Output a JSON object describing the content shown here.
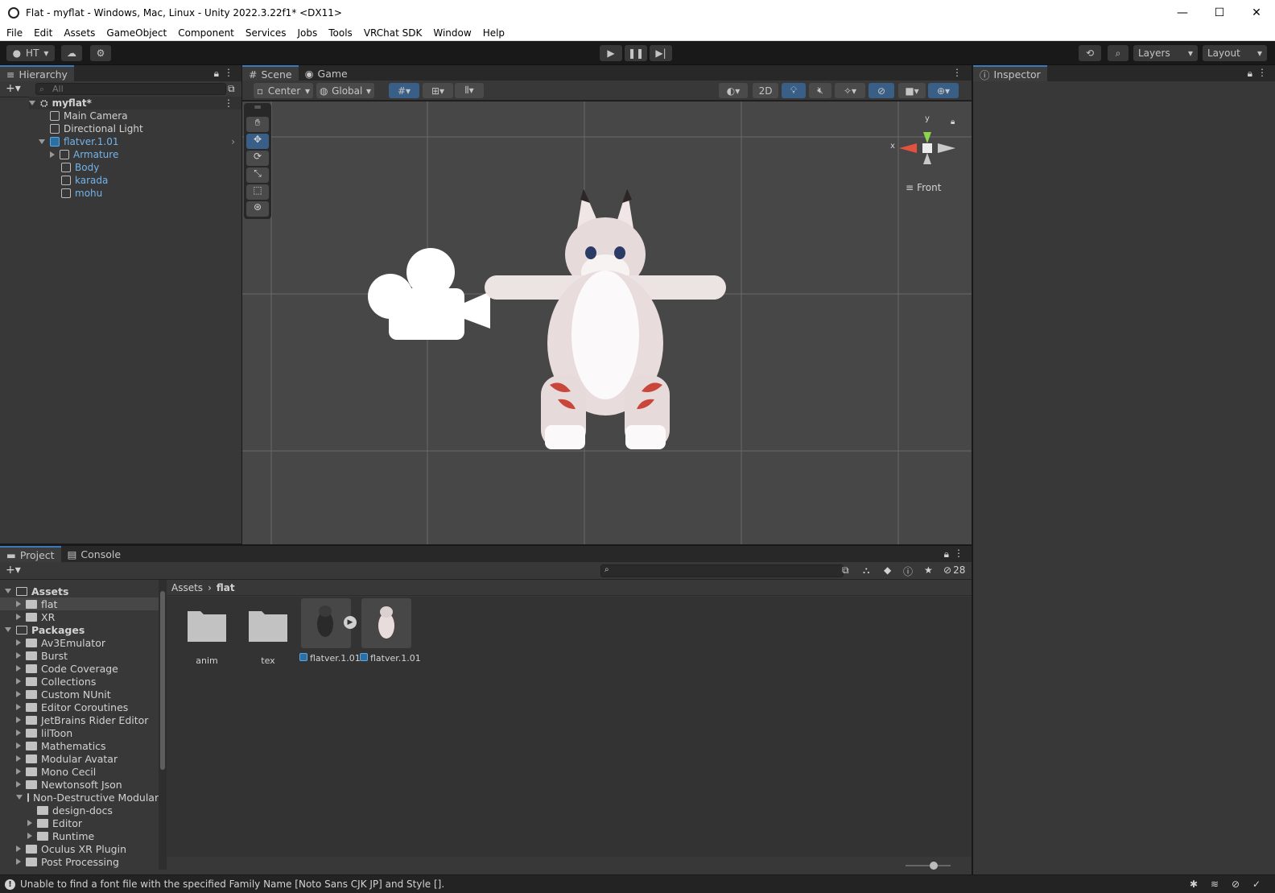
{
  "window": {
    "title": "Flat - myflat - Windows, Mac, Linux - Unity 2022.3.22f1* <DX11>",
    "minimize": "—",
    "maximize": "☐",
    "close": "✕"
  },
  "menu": [
    "File",
    "Edit",
    "Assets",
    "GameObject",
    "Component",
    "Services",
    "Jobs",
    "Tools",
    "VRChat SDK",
    "Window",
    "Help"
  ],
  "toolbar": {
    "account": "HT",
    "layers": "Layers",
    "layout": "Layout"
  },
  "hierarchy": {
    "tab": "Hierarchy",
    "search_placeholder": "All",
    "scene": "myflat*",
    "items": [
      "Main Camera",
      "Directional Light",
      "flatver.1.01",
      "Armature",
      "Body",
      "karada",
      "mohu"
    ]
  },
  "scene": {
    "tabs": [
      "Scene",
      "Game"
    ],
    "pivot": "Center",
    "space": "Global",
    "mode2d": "2D",
    "gizmo_view": "Front",
    "gizmo_y": "y",
    "gizmo_x": "x"
  },
  "inspector": {
    "tab": "Inspector"
  },
  "project": {
    "tabs": [
      "Project",
      "Console"
    ],
    "breadcrumb": [
      "Assets",
      "flat"
    ],
    "hidden_count": "28",
    "tree": [
      {
        "label": "Assets",
        "level": 0,
        "open": true,
        "bold": true
      },
      {
        "label": "flat",
        "level": 1,
        "open": false,
        "selected": true
      },
      {
        "label": "XR",
        "level": 1,
        "open": false
      },
      {
        "label": "Packages",
        "level": 0,
        "open": true,
        "bold": true
      },
      {
        "label": "Av3Emulator",
        "level": 1
      },
      {
        "label": "Burst",
        "level": 1
      },
      {
        "label": "Code Coverage",
        "level": 1
      },
      {
        "label": "Collections",
        "level": 1
      },
      {
        "label": "Custom NUnit",
        "level": 1
      },
      {
        "label": "Editor Coroutines",
        "level": 1
      },
      {
        "label": "JetBrains Rider Editor",
        "level": 1
      },
      {
        "label": "lilToon",
        "level": 1
      },
      {
        "label": "Mathematics",
        "level": 1
      },
      {
        "label": "Modular Avatar",
        "level": 1
      },
      {
        "label": "Mono Cecil",
        "level": 1
      },
      {
        "label": "Newtonsoft Json",
        "level": 1
      },
      {
        "label": "Non-Destructive Modular",
        "level": 1,
        "open": true
      },
      {
        "label": "design-docs",
        "level": 2,
        "noarrow": true
      },
      {
        "label": "Editor",
        "level": 2
      },
      {
        "label": "Runtime",
        "level": 2
      },
      {
        "label": "Oculus XR Plugin",
        "level": 1
      },
      {
        "label": "Post Processing",
        "level": 1
      }
    ],
    "assets": [
      "anim",
      "tex",
      "flatver.1.01",
      "flatver.1.01"
    ]
  },
  "status": {
    "message": "Unable to find a font file with the specified Family Name [Noto Sans CJK JP] and Style []."
  }
}
